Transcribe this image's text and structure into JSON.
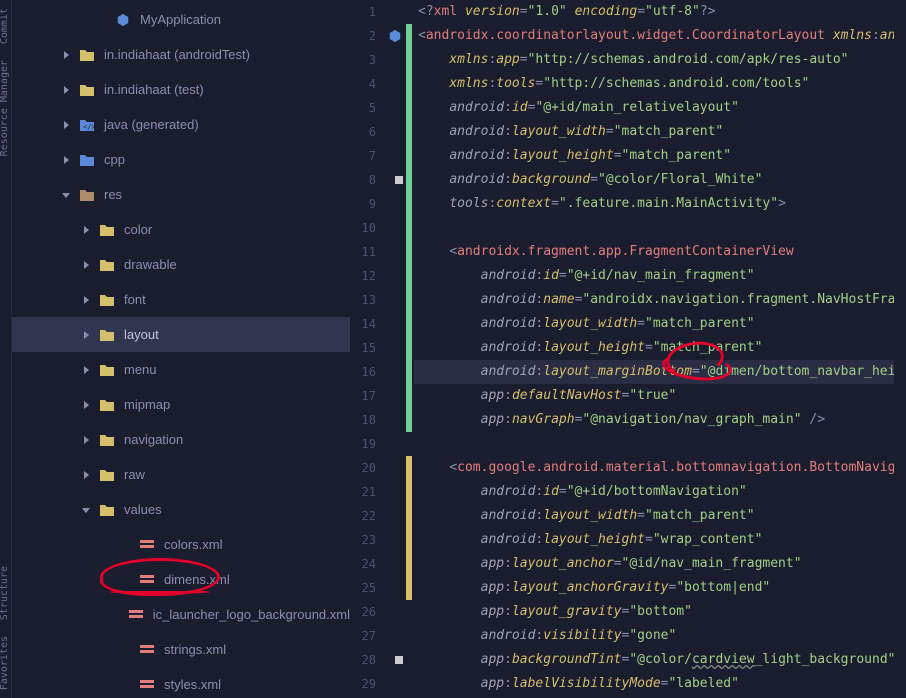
{
  "sidebar_tabs": [
    "Commit",
    "Resource Manager",
    "Structure",
    "Favorites"
  ],
  "tree": [
    {
      "indent": 72,
      "chev": "none",
      "icon": "hex",
      "label": "MyApplication",
      "color": "#5b8bd8"
    },
    {
      "indent": 36,
      "chev": "right",
      "icon": "folder",
      "label": "in.indiahaat (androidTest)",
      "color": "#d4bf6a"
    },
    {
      "indent": 36,
      "chev": "right",
      "icon": "folder",
      "label": "in.indiahaat (test)",
      "color": "#d4bf6a"
    },
    {
      "indent": 36,
      "chev": "right",
      "icon": "code-folder",
      "label": "java (generated)",
      "color": "#5b8bd8"
    },
    {
      "indent": 36,
      "chev": "right",
      "icon": "folder",
      "label": "cpp",
      "color": "#5b8bd8"
    },
    {
      "indent": 36,
      "chev": "down",
      "icon": "folder",
      "label": "res",
      "color": "#b08b6a"
    },
    {
      "indent": 56,
      "chev": "right",
      "icon": "folder",
      "label": "color",
      "color": "#d4bf6a"
    },
    {
      "indent": 56,
      "chev": "right",
      "icon": "folder",
      "label": "drawable",
      "color": "#d4bf6a"
    },
    {
      "indent": 56,
      "chev": "right",
      "icon": "folder",
      "label": "font",
      "color": "#d4bf6a"
    },
    {
      "indent": 56,
      "chev": "right",
      "icon": "folder",
      "label": "layout",
      "color": "#d4bf6a",
      "selected": true
    },
    {
      "indent": 56,
      "chev": "right",
      "icon": "folder",
      "label": "menu",
      "color": "#d4bf6a"
    },
    {
      "indent": 56,
      "chev": "right",
      "icon": "folder",
      "label": "mipmap",
      "color": "#d4bf6a"
    },
    {
      "indent": 56,
      "chev": "right",
      "icon": "folder",
      "label": "navigation",
      "color": "#d4bf6a"
    },
    {
      "indent": 56,
      "chev": "right",
      "icon": "folder",
      "label": "raw",
      "color": "#d4bf6a"
    },
    {
      "indent": 56,
      "chev": "down",
      "icon": "folder",
      "label": "values",
      "color": "#d4bf6a"
    },
    {
      "indent": 96,
      "chev": "none",
      "icon": "xml",
      "label": "colors.xml",
      "color": "#e27d7e"
    },
    {
      "indent": 96,
      "chev": "none",
      "icon": "xml",
      "label": "dimens.xml",
      "color": "#e27d7e",
      "circled": true
    },
    {
      "indent": 96,
      "chev": "none",
      "icon": "xml",
      "label": "ic_launcher_logo_background.xml",
      "color": "#e27d7e"
    },
    {
      "indent": 96,
      "chev": "none",
      "icon": "xml",
      "label": "strings.xml",
      "color": "#e27d7e"
    },
    {
      "indent": 96,
      "chev": "none",
      "icon": "xml",
      "label": "styles.xml",
      "color": "#e27d7e"
    }
  ],
  "code": {
    "lines": [
      {
        "n": 1,
        "html": "<span class='c-punc'>&lt;?</span><span class='c-tag'>xml</span> <span class='c-attr'>version</span><span class='c-punc'>=</span><span class='c-str'>\"1.0\"</span> <span class='c-attr'>encoding</span><span class='c-punc'>=</span><span class='c-str'>\"utf-8\"</span><span class='c-punc'>?&gt;</span>"
      },
      {
        "n": 2,
        "html": "<span class='c-punc'>&lt;</span><span class='c-tag'>androidx.coordinatorlayout.widget.CoordinatorLayout</span> <span class='c-attr'>xmlns</span><span class='c-punc'>:</span><span class='c-attr'>android</span><span class='c-punc'>=</span><span class='c-str'>\"ht</span>",
        "mark": "hex"
      },
      {
        "n": 3,
        "html": "    <span class='c-attr'>xmlns</span><span class='c-punc'>:</span><span class='c-attr'>app</span><span class='c-punc'>=</span><span class='c-str'>\"http://schemas.android.com/apk/res-auto\"</span>"
      },
      {
        "n": 4,
        "html": "    <span class='c-attr'>xmlns</span><span class='c-punc'>:</span><span class='c-attr'>tools</span><span class='c-punc'>=</span><span class='c-str'>\"http://schemas.android.com/tools\"</span>"
      },
      {
        "n": 5,
        "html": "    <span class='c-ns'>android</span><span class='c-punc'>:</span><span class='c-attr'>id</span><span class='c-punc'>=</span><span class='c-str'>\"@+id/main_relativelayout\"</span>"
      },
      {
        "n": 6,
        "html": "    <span class='c-ns'>android</span><span class='c-punc'>:</span><span class='c-attr'>layout_width</span><span class='c-punc'>=</span><span class='c-str'>\"match_parent\"</span>"
      },
      {
        "n": 7,
        "html": "    <span class='c-ns'>android</span><span class='c-punc'>:</span><span class='c-attr'>layout_height</span><span class='c-punc'>=</span><span class='c-str'>\"match_parent\"</span>"
      },
      {
        "n": 8,
        "html": "    <span class='c-ns'>android</span><span class='c-punc'>:</span><span class='c-attr'>background</span><span class='c-punc'>=</span><span class='c-str'>\"@color/Floral_White\"</span>",
        "mark": "dot"
      },
      {
        "n": 9,
        "html": "    <span class='c-ns'>tools</span><span class='c-punc'>:</span><span class='c-attr'>context</span><span class='c-punc'>=</span><span class='c-str'>\".feature.main.MainActivity\"</span><span class='c-punc'>&gt;</span>"
      },
      {
        "n": 10,
        "html": ""
      },
      {
        "n": 11,
        "html": "    <span class='c-punc'>&lt;</span><span class='c-tag'>androidx.fragment.app.FragmentContainerView</span>"
      },
      {
        "n": 12,
        "html": "        <span class='c-ns'>android</span><span class='c-punc'>:</span><span class='c-attr'>id</span><span class='c-punc'>=</span><span class='c-str'>\"@+id/nav_main_fragment\"</span>"
      },
      {
        "n": 13,
        "html": "        <span class='c-ns'>android</span><span class='c-punc'>:</span><span class='c-attr'>name</span><span class='c-punc'>=</span><span class='c-str'>\"androidx.navigation.fragment.NavHostFragment\"</span>"
      },
      {
        "n": 14,
        "html": "        <span class='c-ns'>android</span><span class='c-punc'>:</span><span class='c-attr'>layout_width</span><span class='c-punc'>=</span><span class='c-str'>\"match_parent\"</span>"
      },
      {
        "n": 15,
        "html": "        <span class='c-ns'>android</span><span class='c-punc'>:</span><span class='c-attr'>layout_height</span><span class='c-punc'>=</span><span class='c-str'>\"match_parent\"</span>"
      },
      {
        "n": 16,
        "html": "        <span class='c-ns'>android</span><span class='c-punc'>:</span><span class='c-attr'>layout_marginBottom</span><span class='c-punc'>=</span><span class='c-str'>\"@dimen/bottom_navbar_height\"</span>",
        "hl": true,
        "circled": true
      },
      {
        "n": 17,
        "html": "        <span class='c-ns'>app</span><span class='c-punc'>:</span><span class='c-attr'>defaultNavHost</span><span class='c-punc'>=</span><span class='c-str'>\"true\"</span>"
      },
      {
        "n": 18,
        "html": "        <span class='c-ns'>app</span><span class='c-punc'>:</span><span class='c-attr'>navGraph</span><span class='c-punc'>=</span><span class='c-str'>\"@navigation/nav_graph_main\"</span> <span class='c-punc'>/&gt;</span>"
      },
      {
        "n": 19,
        "html": ""
      },
      {
        "n": 20,
        "html": "    <span class='c-punc'>&lt;</span><span class='c-tag'>com.google.android.material.bottomnavigation.BottomNavigationView</span>"
      },
      {
        "n": 21,
        "html": "        <span class='c-ns'>android</span><span class='c-punc'>:</span><span class='c-attr'>id</span><span class='c-punc'>=</span><span class='c-str'>\"@+id/bottomNavigation\"</span>"
      },
      {
        "n": 22,
        "html": "        <span class='c-ns'>android</span><span class='c-punc'>:</span><span class='c-attr'>layout_width</span><span class='c-punc'>=</span><span class='c-str'>\"match_parent\"</span>"
      },
      {
        "n": 23,
        "html": "        <span class='c-ns'>android</span><span class='c-punc'>:</span><span class='c-attr'>layout_height</span><span class='c-punc'>=</span><span class='c-str'>\"wrap_content\"</span>"
      },
      {
        "n": 24,
        "html": "        <span class='c-ns'>app</span><span class='c-punc'>:</span><span class='c-attr'>layout_anchor</span><span class='c-punc'>=</span><span class='c-str'>\"@id/nav_main_fragment\"</span>"
      },
      {
        "n": 25,
        "html": "        <span class='c-ns'>app</span><span class='c-punc'>:</span><span class='c-attr'>layout_anchorGravity</span><span class='c-punc'>=</span><span class='c-str'>\"bottom|end\"</span>"
      },
      {
        "n": 26,
        "html": "        <span class='c-ns'>app</span><span class='c-punc'>:</span><span class='c-attr'>layout_gravity</span><span class='c-punc'>=</span><span class='c-str'>\"bottom\"</span>"
      },
      {
        "n": 27,
        "html": "        <span class='c-ns'>android</span><span class='c-punc'>:</span><span class='c-attr'>visibility</span><span class='c-punc'>=</span><span class='c-str'>\"gone\"</span>"
      },
      {
        "n": 28,
        "html": "        <span class='c-ns'>app</span><span class='c-punc'>:</span><span class='c-attr'>backgroundTint</span><span class='c-punc'>=</span><span class='c-str'>\"@color/<span style='text-decoration:underline wavy #888'>cardview</span>_light_background\"</span>",
        "mark": "dot"
      },
      {
        "n": 29,
        "html": "        <span class='c-ns'>app</span><span class='c-punc'>:</span><span class='c-attr'>labelVisibilityMode</span><span class='c-punc'>=</span><span class='c-str'>\"labeled\"</span>"
      }
    ]
  },
  "annotations": {
    "tree_circle": {
      "file": "dimens.xml"
    },
    "code_circle": {
      "line": 16,
      "text": "@dimen/bottom_navbar_height"
    }
  }
}
